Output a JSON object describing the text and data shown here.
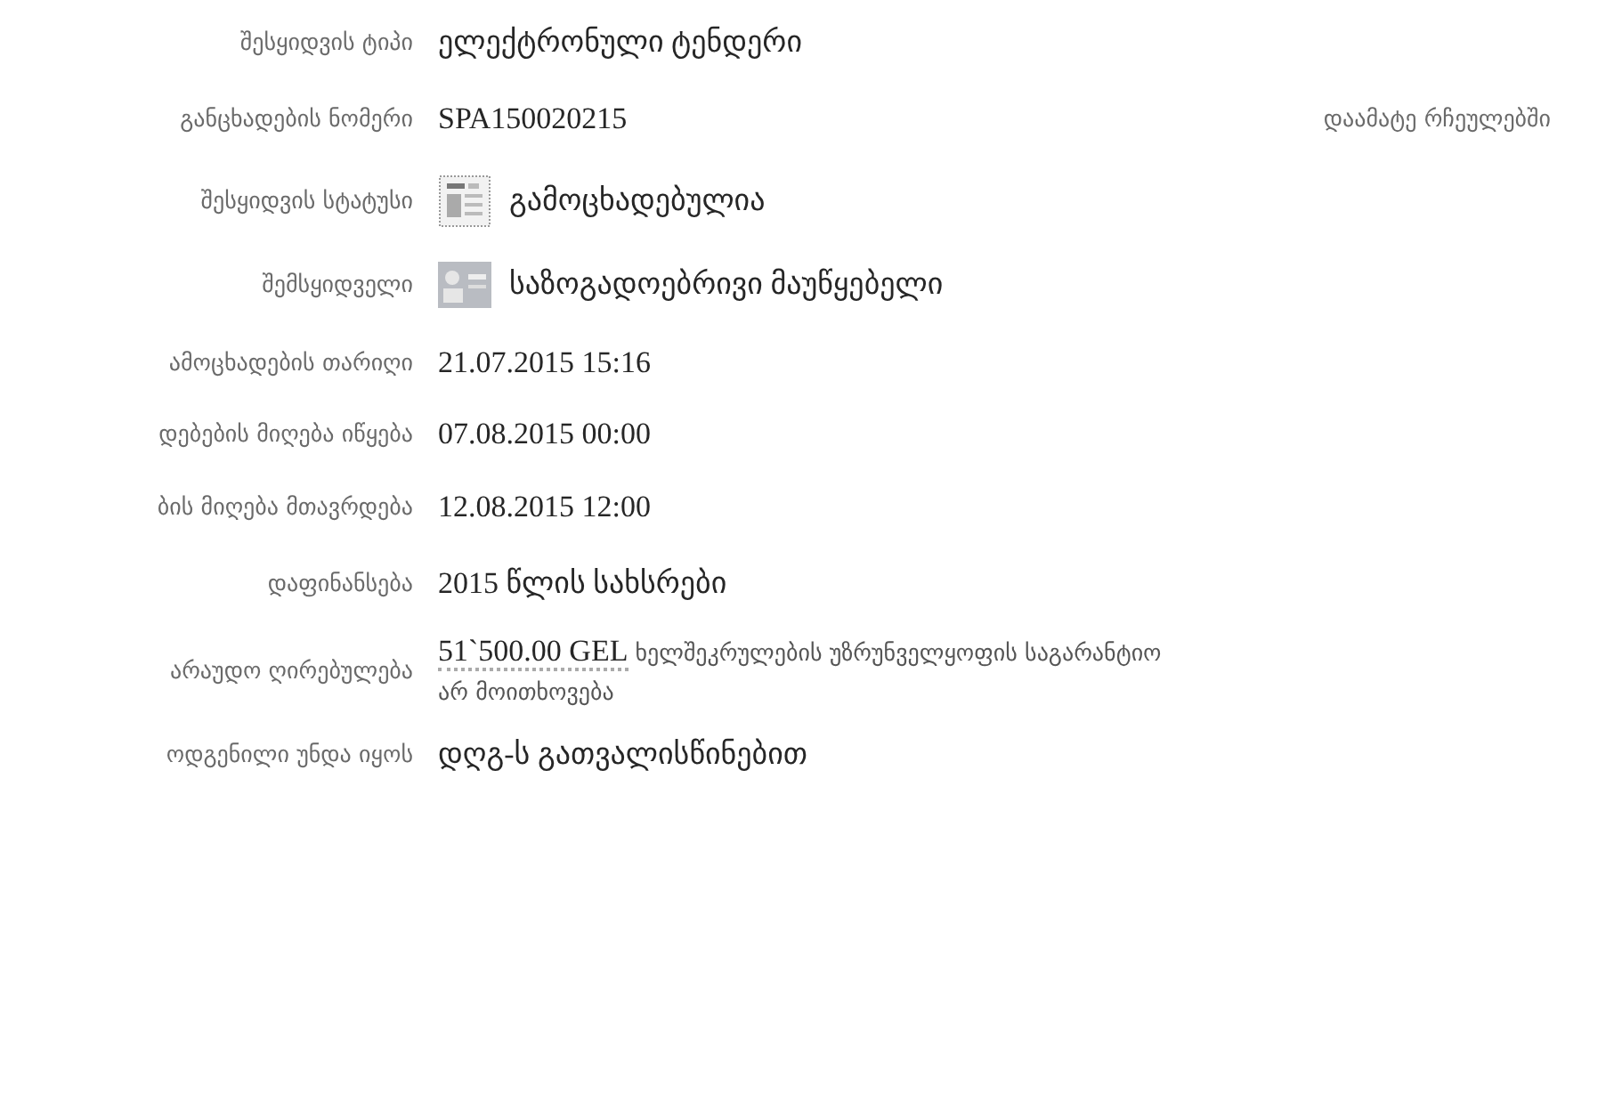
{
  "favorites_link": "დაამატე რჩეულებში",
  "rows": [
    {
      "kind": "text",
      "label": "შესყიდვის ტიპი",
      "value": "ელექტრონული ტენდერი"
    },
    {
      "kind": "text",
      "label": "განცხადების ნომერი",
      "value": "SPA150020215"
    },
    {
      "kind": "status",
      "label": "შესყიდვის სტატუსი",
      "value": "გამოცხადებულია"
    },
    {
      "kind": "buyer",
      "label": "შემსყიდველი",
      "value": "საზოგადოებრივი მაუწყებელი"
    },
    {
      "kind": "text",
      "label": "ამოცხადების თარიღი",
      "value": "21.07.2015 15:16"
    },
    {
      "kind": "text",
      "label": "დებების მიღება იწყება",
      "value": "07.08.2015 00:00"
    },
    {
      "kind": "text",
      "label": "ბის მიღება მთავრდება",
      "value": "12.08.2015 12:00"
    },
    {
      "kind": "text",
      "label": "დაფინანსება",
      "value": "2015 წლის სახსრები"
    },
    {
      "kind": "amount",
      "label": "არაუდო ღირებულება",
      "value": "51`500.00 GEL",
      "note": "ხელშეკრულების უზრუნველყოფის საგარანტიო არ მოითხოვება"
    },
    {
      "kind": "text",
      "label": "ოდგენილი უნდა იყოს",
      "value": "დღგ-ს გათვალისწინებით"
    }
  ]
}
